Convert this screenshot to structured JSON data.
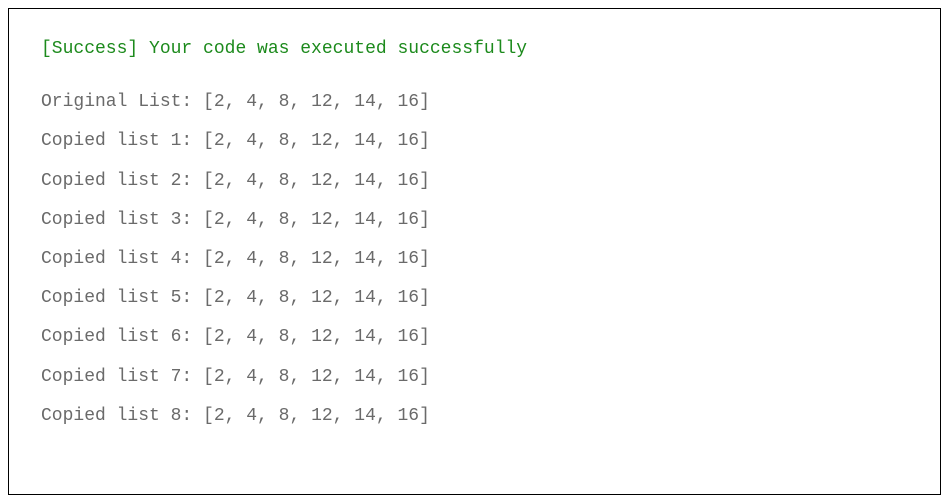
{
  "status": {
    "prefix": "[Success]",
    "message": "Your code was executed successfully"
  },
  "output": [
    {
      "label": "Original List:",
      "value": "[2, 4, 8, 12, 14, 16]"
    },
    {
      "label": "Copied list 1:",
      "value": "[2, 4, 8, 12, 14, 16]"
    },
    {
      "label": "Copied list 2:",
      "value": "[2, 4, 8, 12, 14, 16]"
    },
    {
      "label": "Copied list 3:",
      "value": "[2, 4, 8, 12, 14, 16]"
    },
    {
      "label": "Copied list 4:",
      "value": "[2, 4, 8, 12, 14, 16]"
    },
    {
      "label": "Copied list 5:",
      "value": "[2, 4, 8, 12, 14, 16]"
    },
    {
      "label": "Copied list 6:",
      "value": "[2, 4, 8, 12, 14, 16]"
    },
    {
      "label": "Copied list 7:",
      "value": "[2, 4, 8, 12, 14, 16]"
    },
    {
      "label": "Copied list 8:",
      "value": "[2, 4, 8, 12, 14, 16]"
    }
  ]
}
